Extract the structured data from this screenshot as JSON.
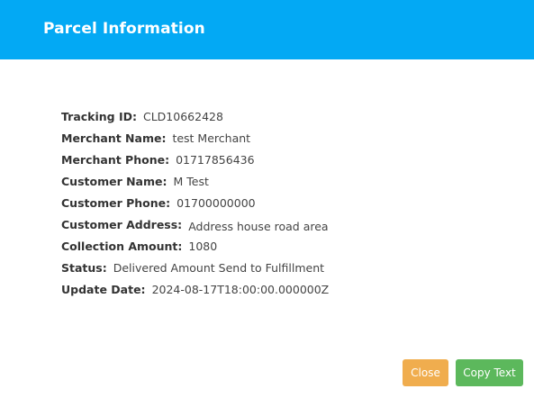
{
  "header": {
    "title": "Parcel Information",
    "color": "#03a9f4"
  },
  "parcel": {
    "fields": [
      {
        "label": "Tracking ID:",
        "value": "CLD10662428"
      },
      {
        "label": "Merchant Name:",
        "value": "test Merchant"
      },
      {
        "label": "Merchant Phone:",
        "value": "01717856436"
      },
      {
        "label": "Customer Name:",
        "value": "M Test"
      },
      {
        "label": "Customer Phone:",
        "value": "01700000000"
      },
      {
        "label": "Customer Address:",
        "value": "Address house road area"
      },
      {
        "label": "Collection Amount:",
        "value": "1080"
      },
      {
        "label": "Status:",
        "value": "Delivered Amount Send to Fulfillment"
      },
      {
        "label": "Update Date:",
        "value": "2024-08-17T18:00:00.000000Z"
      }
    ]
  },
  "footer": {
    "close_label": "Close",
    "close_color": "#f0ad4e",
    "copy_label": "Copy Text",
    "copy_color": "#5cb85c"
  }
}
